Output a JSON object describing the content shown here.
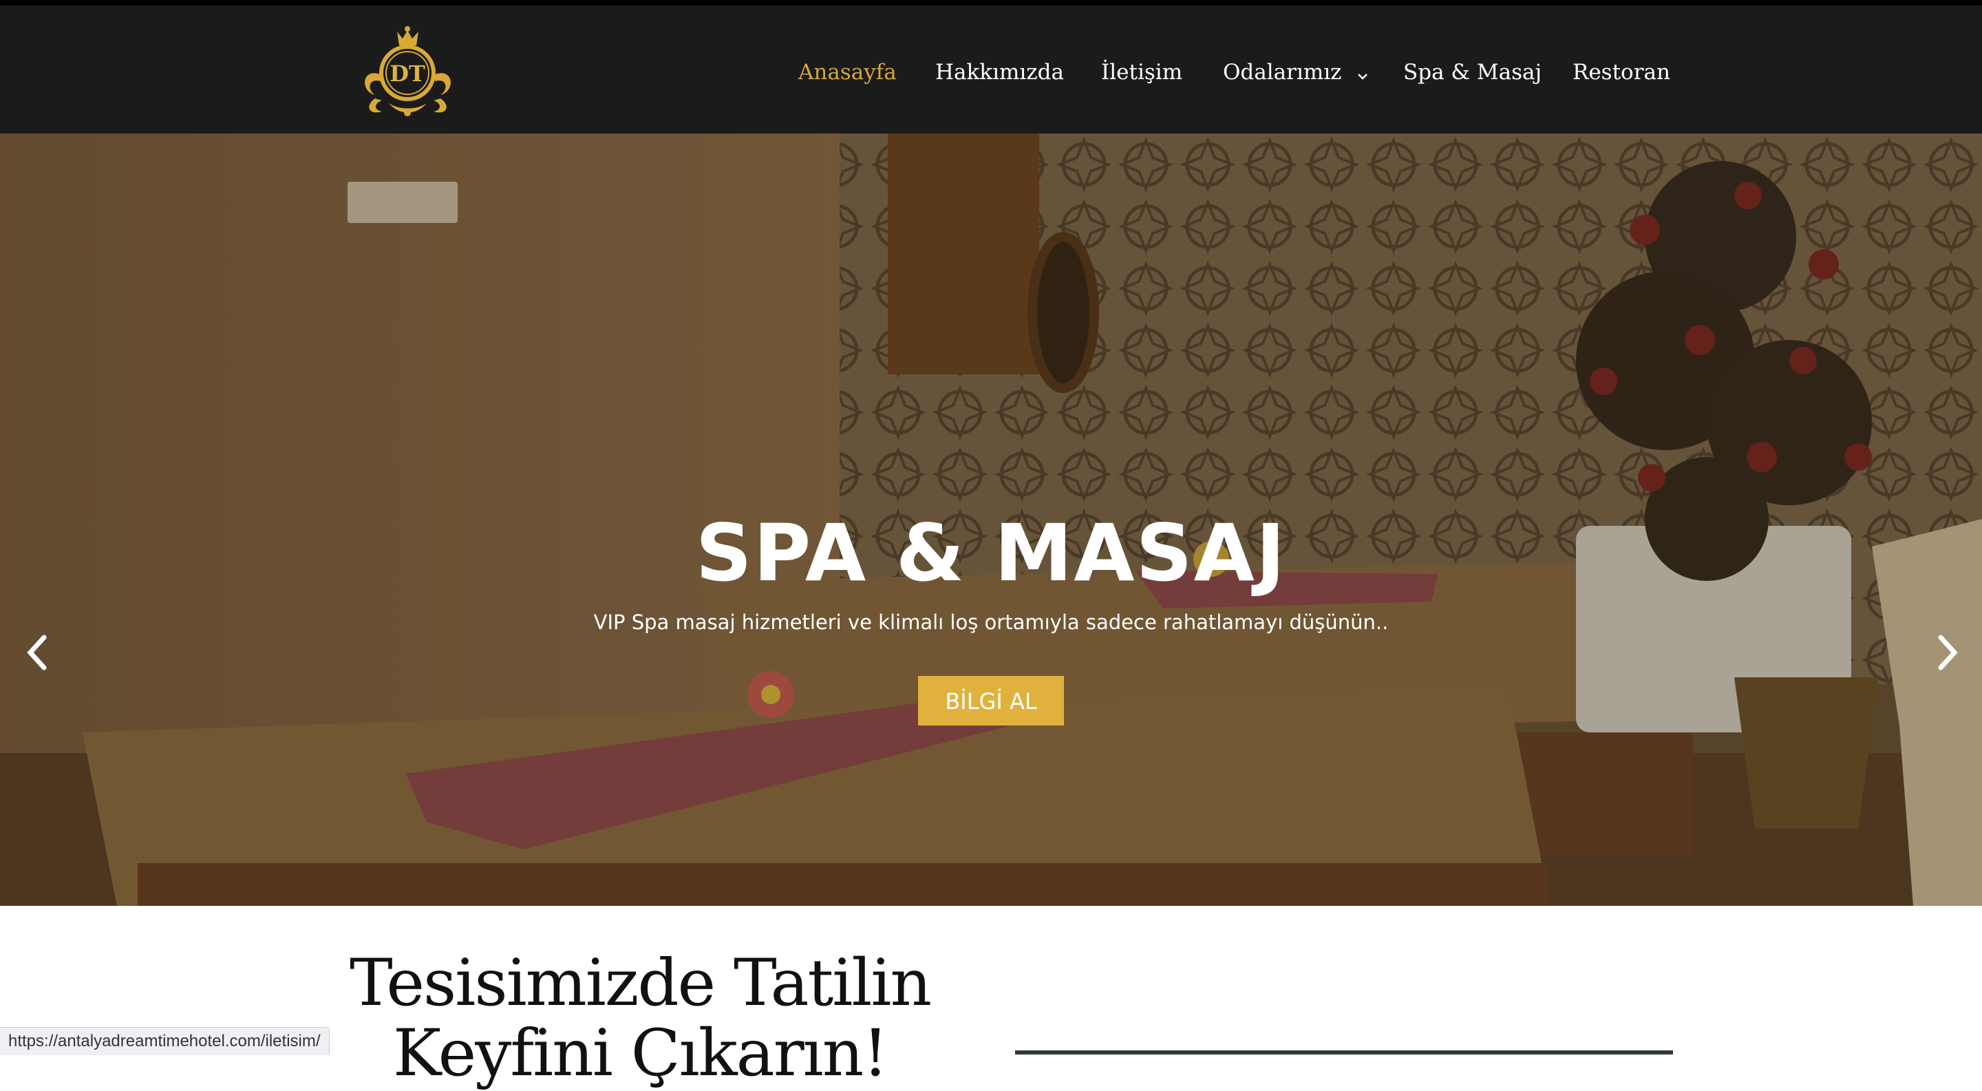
{
  "nav": {
    "items": [
      {
        "label": "Anasayfa"
      },
      {
        "label": "Hakkımızda"
      },
      {
        "label": "İletişim"
      },
      {
        "label": "Odalarımız"
      },
      {
        "label": "Spa & Masaj"
      },
      {
        "label": "Restoran"
      }
    ],
    "active_index": 0
  },
  "logo": {
    "monogram": "DT"
  },
  "hero": {
    "title": "SPA & MASAJ",
    "subtitle": "VIP Spa masaj hizmetleri ve klimalı loş ortamıyla sadece rahatlamayı düşünün..",
    "button": "BİLGİ AL"
  },
  "section": {
    "title_line1": "Tesisimizde Tatilin",
    "title_line2": "Keyfini Çıkarın!"
  },
  "status_bar": {
    "url": "https://antalyadreamtimehotel.com/iletisim/"
  },
  "colors": {
    "header_bg": "#1b1b1b",
    "accent_gold": "#d5a83a",
    "button_gold": "#e0b23d"
  },
  "icons": {
    "logo": "dt-crest-logo",
    "dropdown": "chevron-down-icon",
    "prev": "chevron-left-icon",
    "next": "chevron-right-icon"
  }
}
